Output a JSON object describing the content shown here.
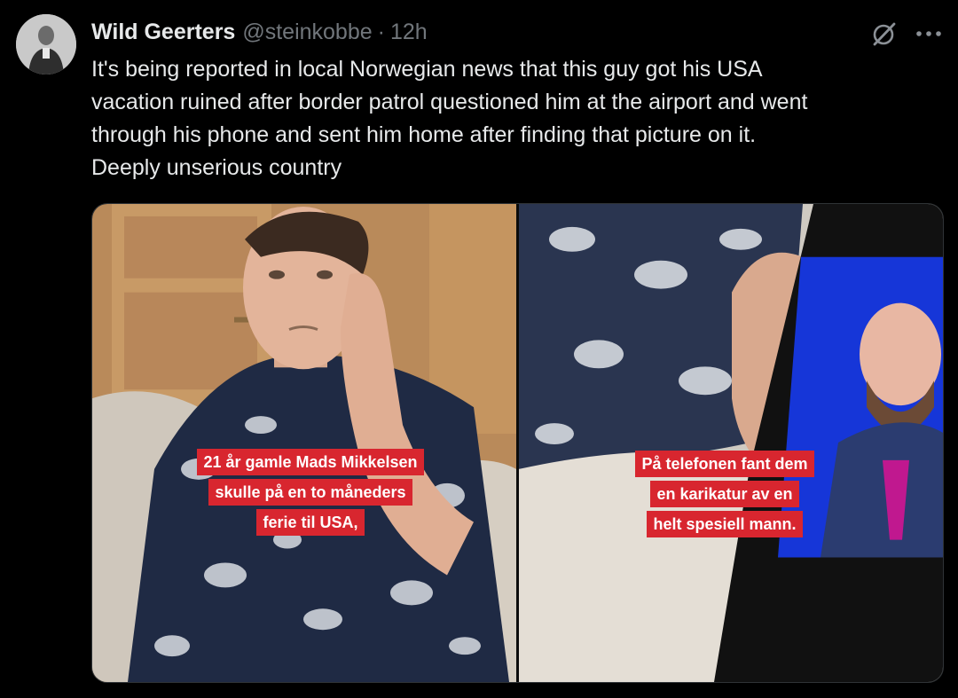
{
  "tweet": {
    "author_name": "Wild Geerters",
    "author_handle": "@steinkobbe",
    "separator": "·",
    "time": "12h",
    "text_lines": [
      "It's being reported in local Norwegian news that this guy got his USA",
      "vacation ruined after border patrol questioned him at the airport and went",
      "through his phone and sent him home after finding that picture on it.",
      "Deeply unserious country"
    ]
  },
  "icons": {
    "avatar": "avatar-portrait",
    "grok": "grok-icon",
    "more": "more-options-icon"
  },
  "media": {
    "left_caption": [
      "21 år gamle Mads Mikkelsen",
      "skulle på en to måneders",
      "ferie til USA,"
    ],
    "right_caption": [
      "På telefonen fant dem",
      "en karikatur av en",
      "helt spesiell mann."
    ]
  },
  "colors": {
    "background": "#000000",
    "text_primary": "#e7e9ea",
    "text_secondary": "#71767b",
    "caption_red": "#d8262f"
  }
}
